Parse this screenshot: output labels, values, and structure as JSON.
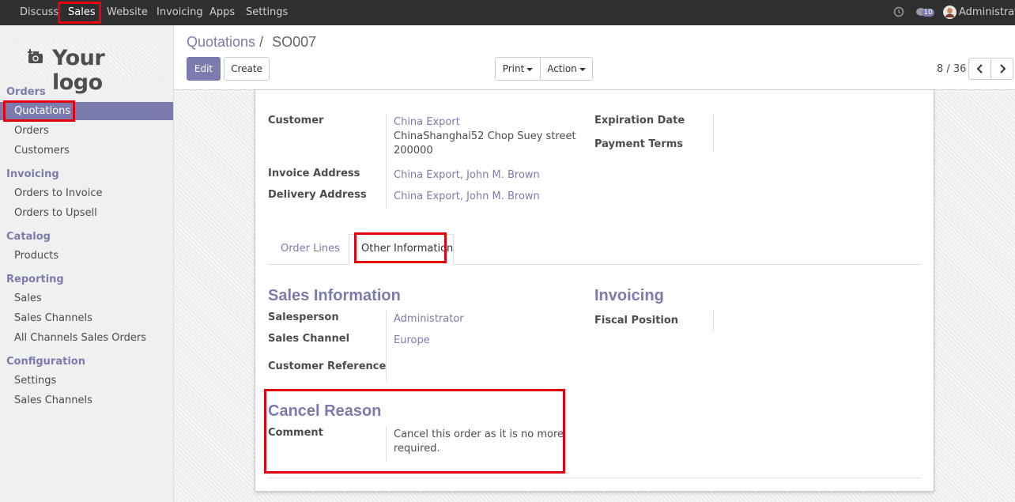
{
  "topbar": {
    "menus": [
      "Discuss",
      "Sales",
      "Website",
      "Invoicing",
      "Apps",
      "Settings"
    ],
    "chat_count": "10",
    "user": "Administrator"
  },
  "sidebar": {
    "logo": "Your logo",
    "sections": [
      {
        "title": "Orders",
        "items": [
          "Quotations",
          "Orders",
          "Customers"
        ]
      },
      {
        "title": "Invoicing",
        "items": [
          "Orders to Invoice",
          "Orders to Upsell"
        ]
      },
      {
        "title": "Catalog",
        "items": [
          "Products"
        ]
      },
      {
        "title": "Reporting",
        "items": [
          "Sales",
          "Sales Channels",
          "All Channels Sales Orders"
        ]
      },
      {
        "title": "Configuration",
        "items": [
          "Settings",
          "Sales Channels"
        ]
      }
    ]
  },
  "breadcrumb": {
    "parent": "Quotations",
    "separator": "/",
    "current": "SO007"
  },
  "buttons": {
    "edit": "Edit",
    "create": "Create",
    "print": "Print",
    "action": "Action"
  },
  "pager": {
    "text": "8 / 36"
  },
  "form": {
    "customer_label": "Customer",
    "customer_name": "China Export",
    "customer_address1": "ChinaShanghai52 Chop Suey street",
    "customer_address2": "200000",
    "invoice_address_label": "Invoice Address",
    "invoice_address": "China Export, John M. Brown",
    "delivery_address_label": "Delivery Address",
    "delivery_address": "China Export, John M. Brown",
    "expiration_date_label": "Expiration Date",
    "payment_terms_label": "Payment Terms"
  },
  "tabs": {
    "order_lines": "Order Lines",
    "other_info": "Other Information"
  },
  "sales_info": {
    "title": "Sales Information",
    "salesperson_label": "Salesperson",
    "salesperson": "Administrator",
    "channel_label": "Sales Channel",
    "channel": "Europe",
    "customer_ref_label": "Customer Reference"
  },
  "invoicing": {
    "title": "Invoicing",
    "fiscal_position_label": "Fiscal Position"
  },
  "cancel": {
    "title": "Cancel Reason",
    "comment_label": "Comment",
    "comment_line1": "Cancel this order as it is no more",
    "comment_line2": "required."
  },
  "colors": {
    "brand": "#7c7bad",
    "highlight": "#e3000f",
    "topbar": "#2f2f2f"
  }
}
